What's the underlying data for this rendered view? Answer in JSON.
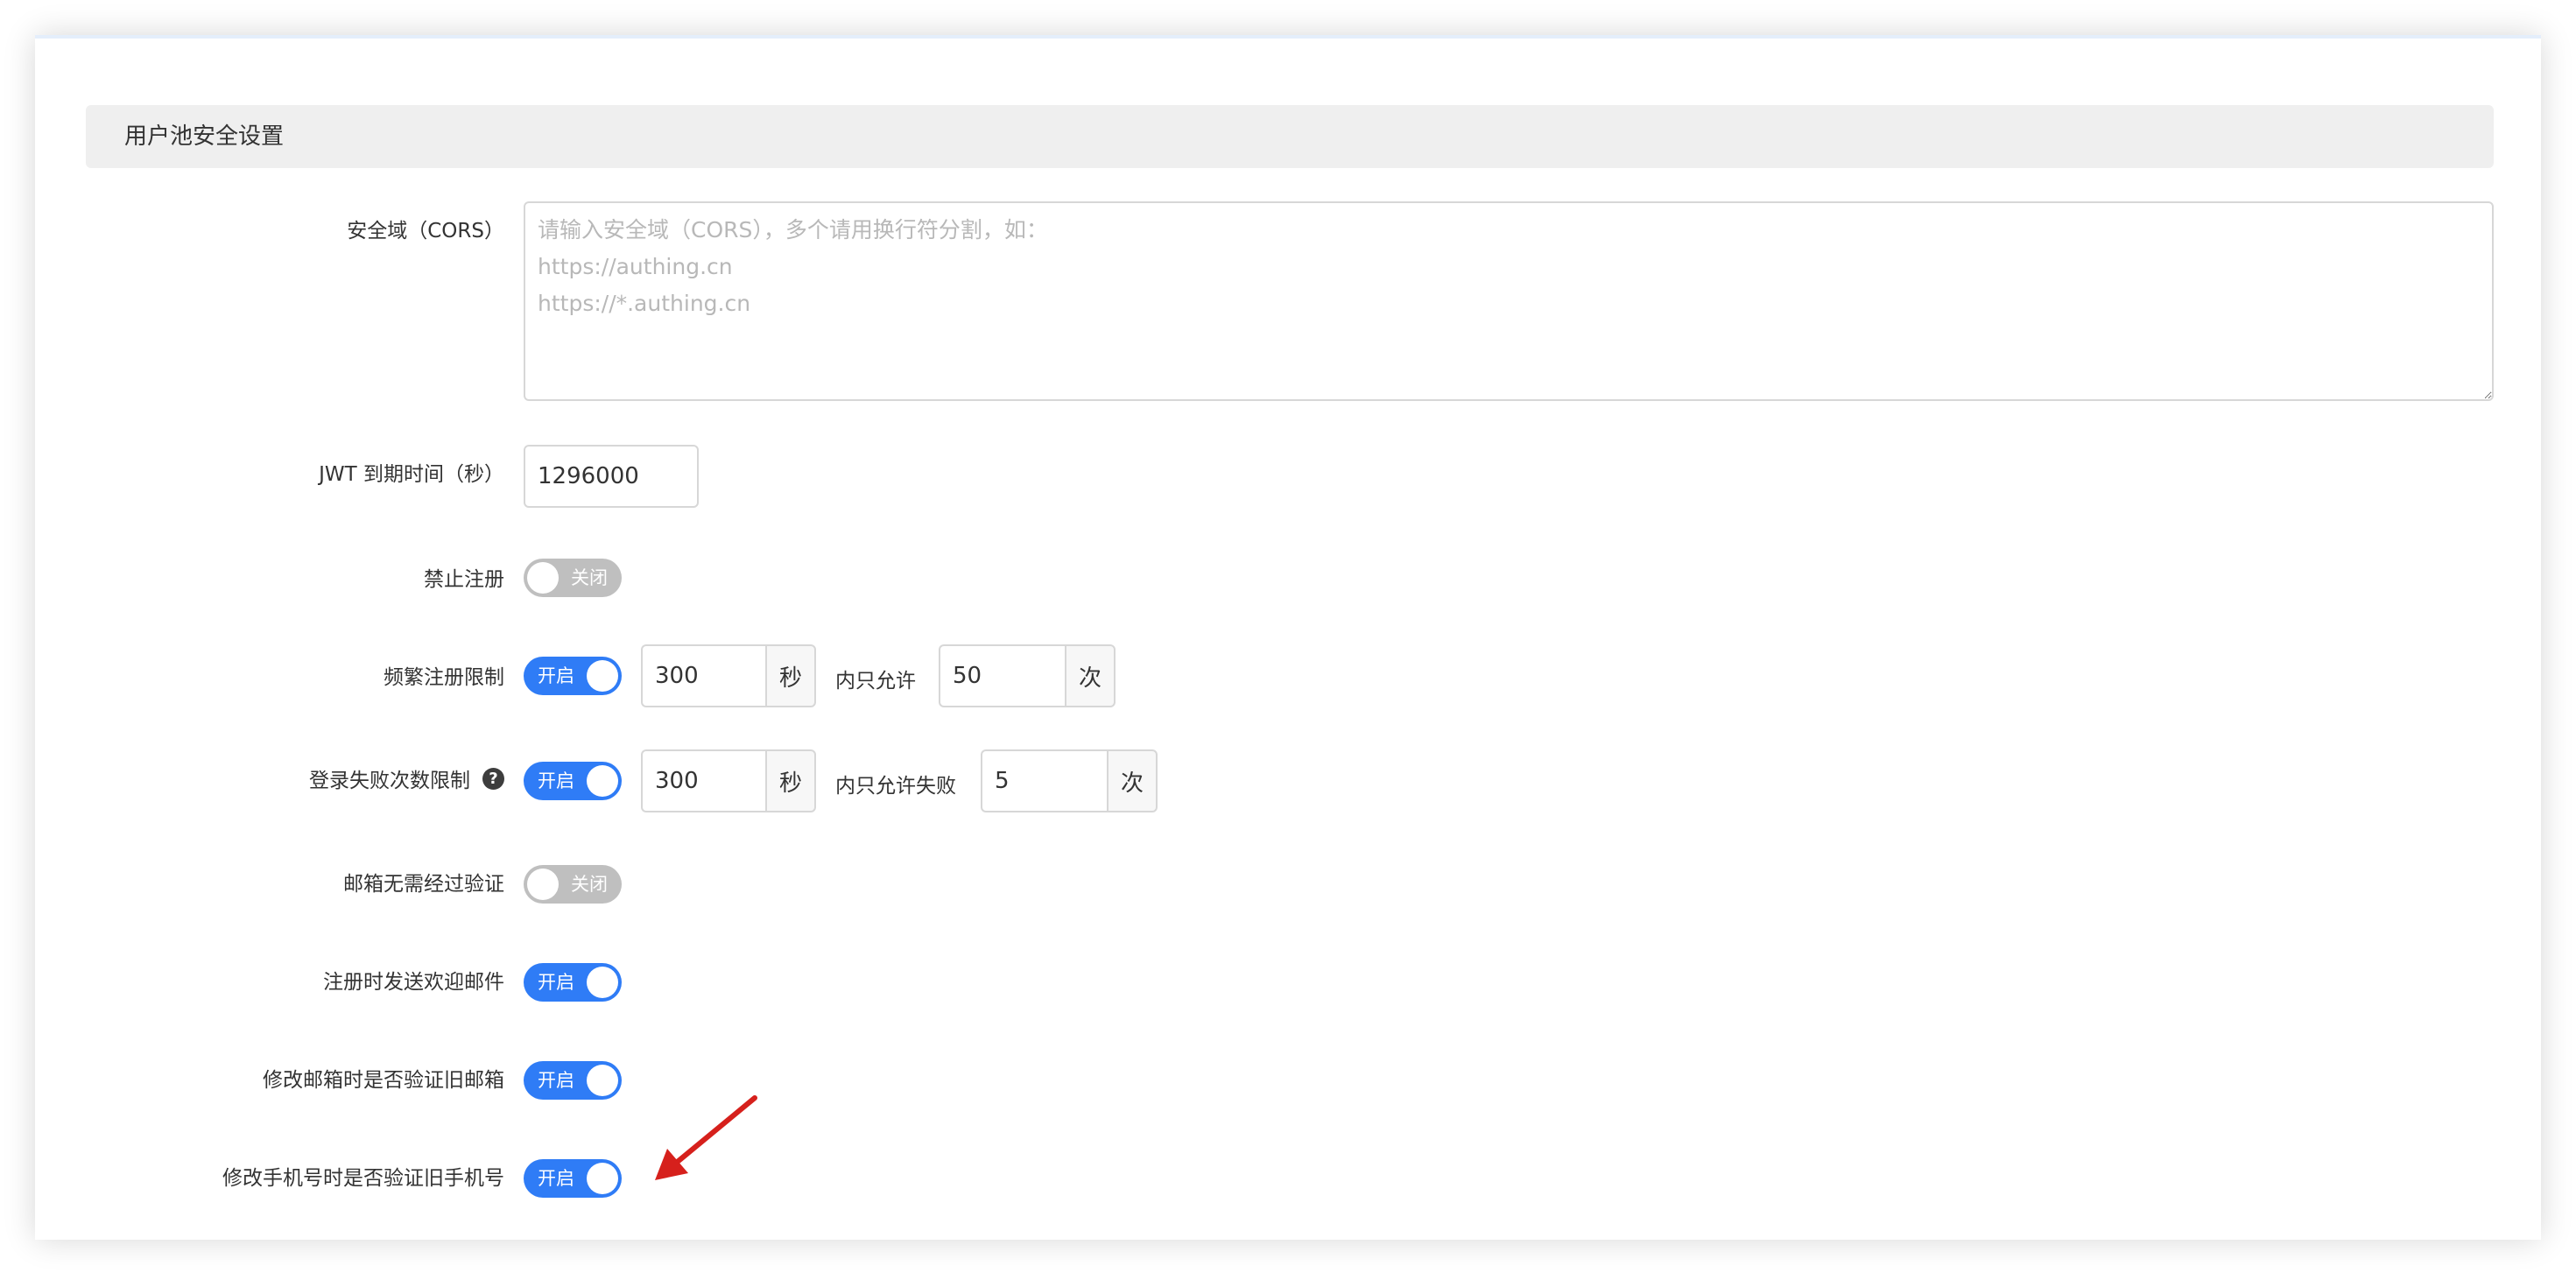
{
  "section": {
    "title": "用户池安全设置"
  },
  "cors": {
    "label": "安全域（CORS）",
    "placeholder": "请输入安全域（CORS），多个请用换行符分割，如：\nhttps://authing.cn\nhttps://*.authing.cn",
    "value": ""
  },
  "jwt": {
    "label": "JWT 到期时间（秒）",
    "value": "1296000"
  },
  "disable_register": {
    "label": "禁止注册",
    "state_text": "关闭",
    "on": false
  },
  "frequent_register": {
    "label": "频繁注册限制",
    "state_text": "开启",
    "on": true,
    "seconds_value": "300",
    "seconds_unit": "秒",
    "middle_text": "内只允许",
    "count_value": "50",
    "count_unit": "次"
  },
  "login_fail": {
    "label": "登录失败次数限制",
    "help_icon": "question-circle-icon",
    "help_glyph": "?",
    "state_text": "开启",
    "on": true,
    "seconds_value": "300",
    "seconds_unit": "秒",
    "middle_text": "内只允许失败",
    "count_value": "5",
    "count_unit": "次"
  },
  "email_no_verify": {
    "label": "邮箱无需经过验证",
    "state_text": "关闭",
    "on": false
  },
  "welcome_email": {
    "label": "注册时发送欢迎邮件",
    "state_text": "开启",
    "on": true
  },
  "verify_old_email": {
    "label": "修改邮箱时是否验证旧邮箱",
    "state_text": "开启",
    "on": true
  },
  "verify_old_phone": {
    "label": "修改手机号时是否验证旧手机号",
    "state_text": "开启",
    "on": true
  },
  "colors": {
    "switch_on": "#2f7cf6",
    "switch_off": "#bfbfbf",
    "annotation_arrow": "#d6201c"
  },
  "annotation": {
    "icon": "red-arrow-icon"
  }
}
